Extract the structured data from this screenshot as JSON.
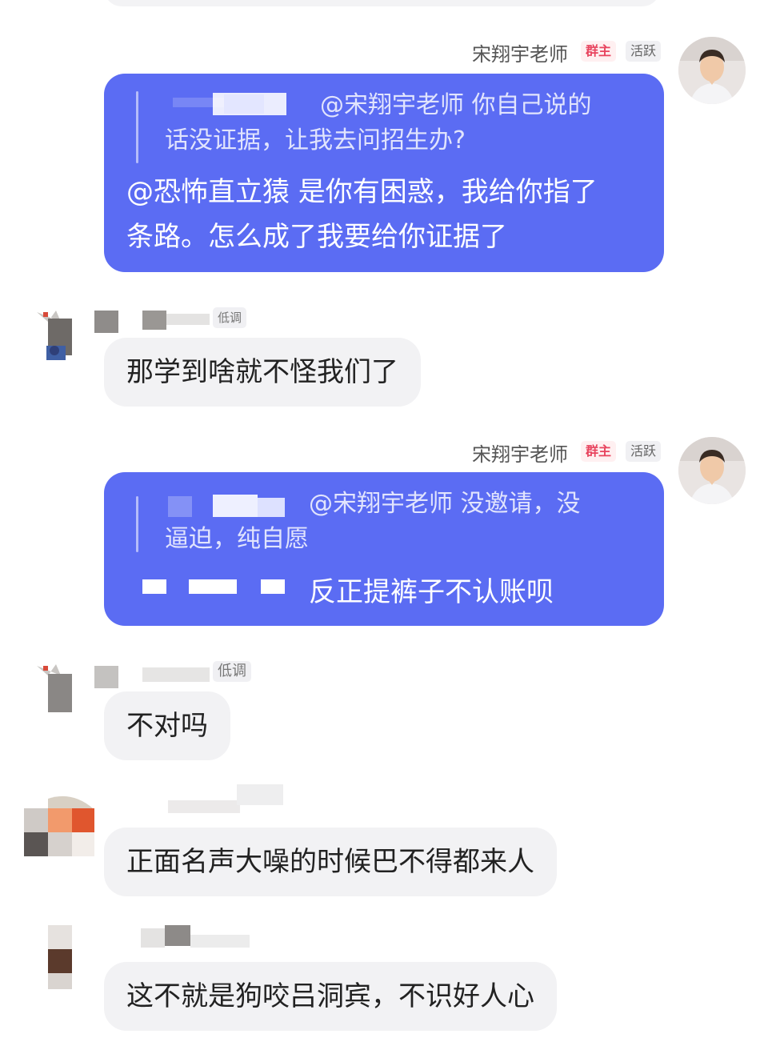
{
  "messages": [
    {
      "sender": "宋翔宇老师",
      "badges": [
        "群主",
        "活跃"
      ],
      "quote_prefix": "@宋翔宇老师 你自己说的",
      "quote_rest": "话没证据，让我去问招生办?",
      "text_line1": "@恐怖直立猿 是你有困惑，我给你指了",
      "text_line2": "条路。怎么成了我要给你证据了"
    },
    {
      "badge": "低调",
      "text": "那学到啥就不怪我们了"
    },
    {
      "sender": "宋翔宇老师",
      "badges": [
        "群主",
        "活跃"
      ],
      "quote_prefix": "@宋翔宇老师 没邀请，没",
      "quote_rest": "逼迫，纯自愿",
      "text": "反正提裤子不认账呗"
    },
    {
      "badge": "低调",
      "text": "不对吗"
    },
    {
      "text": "正面名声大噪的时候巴不得都来人"
    },
    {
      "text": "这不就是狗咬吕洞宾，不识好人心"
    }
  ],
  "colors": {
    "bubble_blue": "#5b6cf3",
    "bubble_grey": "#f2f2f4",
    "badge_owner": "#e8455f"
  }
}
